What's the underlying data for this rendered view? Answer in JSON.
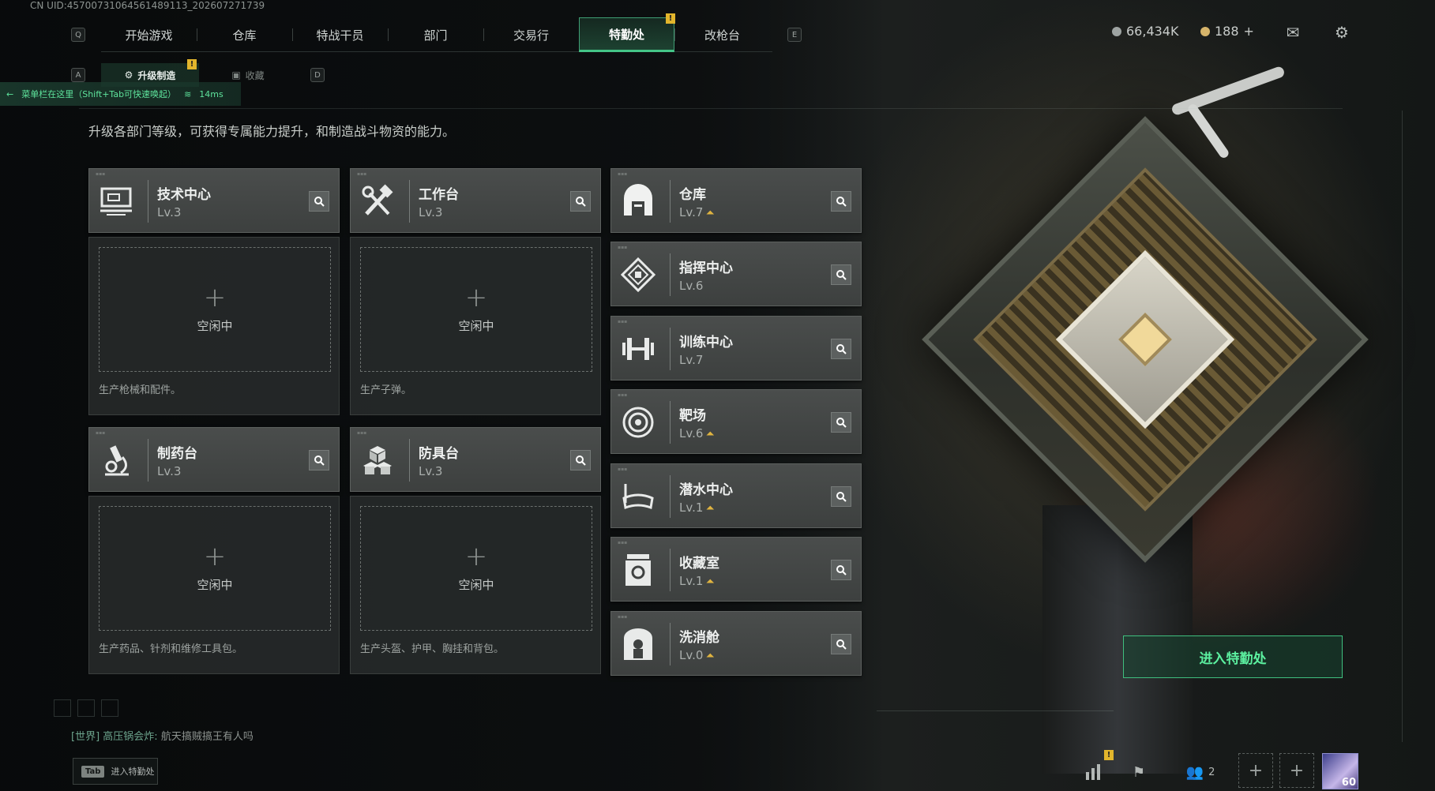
{
  "uid": "CN UID:45700731064561489113_202607271739",
  "nav": {
    "left_key": "Q",
    "right_key": "E",
    "items": [
      {
        "label": "开始游戏"
      },
      {
        "label": "仓库"
      },
      {
        "label": "特战干员"
      },
      {
        "label": "部门"
      },
      {
        "label": "交易行"
      },
      {
        "label": "特勤处"
      },
      {
        "label": "改枪台"
      }
    ],
    "active_index": 5,
    "badge": "!"
  },
  "currency": {
    "silver": "66,434K",
    "gold": "188",
    "gold_add": "+"
  },
  "subtabs": {
    "left_key": "A",
    "right_key": "D",
    "items": [
      {
        "label": "升级制造"
      },
      {
        "label": "收藏"
      }
    ],
    "badge": "!"
  },
  "menubar_tip": {
    "text": "菜单栏在这里（Shift+Tab可快速唤起）",
    "ping": "14ms"
  },
  "description": "升级各部门等级，可获得专属能力提升，和制造战斗物资的能力。",
  "production": [
    {
      "title": "技术中心",
      "level": "Lv.3",
      "idle": "空闲中",
      "desc": "生产枪械和配件。",
      "icon": "computer-icon"
    },
    {
      "title": "工作台",
      "level": "Lv.3",
      "idle": "空闲中",
      "desc": "生产子弹。",
      "icon": "tools-icon"
    },
    {
      "title": "制药台",
      "level": "Lv.3",
      "idle": "空闲中",
      "desc": "生产药品、针剂和维修工具包。",
      "icon": "microscope-icon"
    },
    {
      "title": "防具台",
      "level": "Lv.3",
      "idle": "空闲中",
      "desc": "生产头盔、护甲、胸挂和背包。",
      "icon": "boxes-icon"
    }
  ],
  "facilities": [
    {
      "title": "仓库",
      "level": "Lv.7",
      "upgradable": true,
      "icon": "warehouse-icon"
    },
    {
      "title": "指挥中心",
      "level": "Lv.6",
      "upgradable": false,
      "icon": "command-icon"
    },
    {
      "title": "训练中心",
      "level": "Lv.7",
      "upgradable": false,
      "icon": "dumbbell-icon"
    },
    {
      "title": "靶场",
      "level": "Lv.6",
      "upgradable": true,
      "icon": "target-icon"
    },
    {
      "title": "潜水中心",
      "level": "Lv.1",
      "upgradable": true,
      "icon": "diving-mask-icon"
    },
    {
      "title": "收藏室",
      "level": "Lv.1",
      "upgradable": true,
      "icon": "collection-icon"
    },
    {
      "title": "洗消舱",
      "level": "Lv.0",
      "upgradable": true,
      "icon": "decontam-icon"
    }
  ],
  "enter_button": "进入特勤处",
  "chat": {
    "channel": "[世界]",
    "sender": "高压锅会炸:",
    "message": "航天搞贼搞王有人吗"
  },
  "tab_hint": {
    "key": "Tab",
    "label": "进入特勤处"
  },
  "bottom": {
    "friends_count": "2",
    "level": "60",
    "plus": "+"
  },
  "colors": {
    "accent_green": "#44c587",
    "upgrade_gold": "#e0b440",
    "warning_badge": "#e2b52c"
  }
}
